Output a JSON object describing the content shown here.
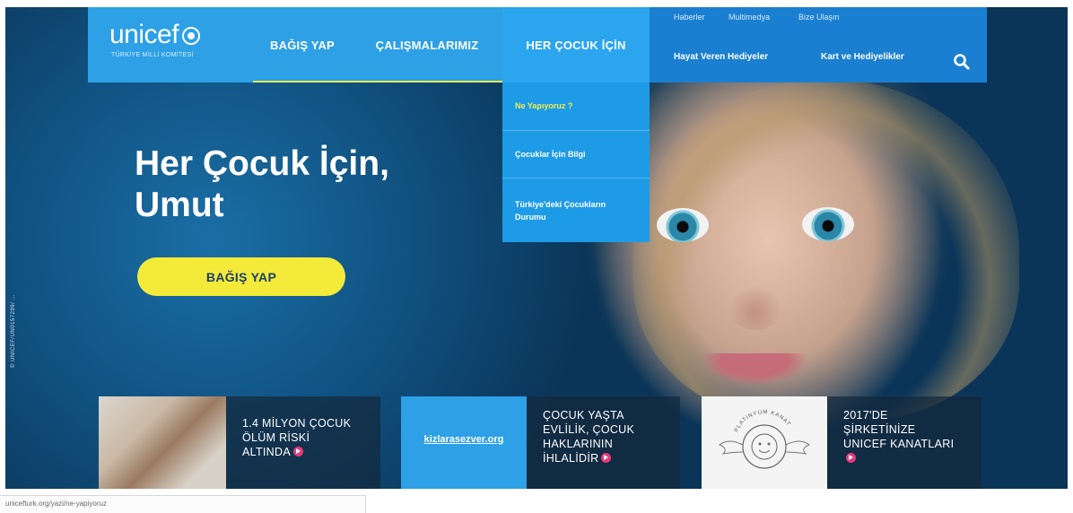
{
  "logo": {
    "wordmark": "unicef",
    "subtitle": "TÜRKİYE MİLLİ KOMİTESİ"
  },
  "nav": {
    "items": [
      {
        "label": "BAĞIŞ YAP"
      },
      {
        "label": "ÇALIŞMALARIMIZ"
      },
      {
        "label": "HER ÇOCUK İÇİN"
      }
    ]
  },
  "utility_links": [
    "Haberler",
    "Multimedya",
    "Bize Ulaşın"
  ],
  "secondary_links": [
    "Hayat Veren Hediyeler",
    "Kart ve Hediyelikler"
  ],
  "dropdown": {
    "items": [
      {
        "label": "Ne Yapıyoruz ?"
      },
      {
        "label": "Çocuklar İçin Bilgi"
      },
      {
        "label": "Türkiye'deki Çocukların Durumu"
      }
    ]
  },
  "hero": {
    "title_line1": "Her Çocuk İçin,",
    "title_line2": "Umut",
    "button_label": "BAĞIŞ YAP",
    "photo_credit": "© UNICEF/UN0157299/ ..."
  },
  "cards": [
    {
      "lines": [
        "1.4 MİLYON ÇOCUK",
        "ÖLÜM RİSKİ",
        "ALTINDA"
      ]
    },
    {
      "site": "kizlarasezver.org",
      "lines": [
        "ÇOCUK YAŞTA",
        "EVLİLİK, ÇOCUK",
        "HAKLARININ",
        "İHLALİDİR"
      ]
    },
    {
      "badge": "PLATİNYUM KANAT",
      "lines": [
        "2017'DE",
        "ŞİRKETİNİZE",
        "UNICEF KANATLARI"
      ]
    }
  ],
  "status_bar": {
    "text": "unicefturk.org/yazi/ne-yapiyoruz"
  },
  "colors": {
    "nav_blue": "#2da0e6",
    "nav_right_blue": "#1a7fd0",
    "accent_yellow": "#f4ea3a",
    "arrow_pink": "#e8397a"
  }
}
